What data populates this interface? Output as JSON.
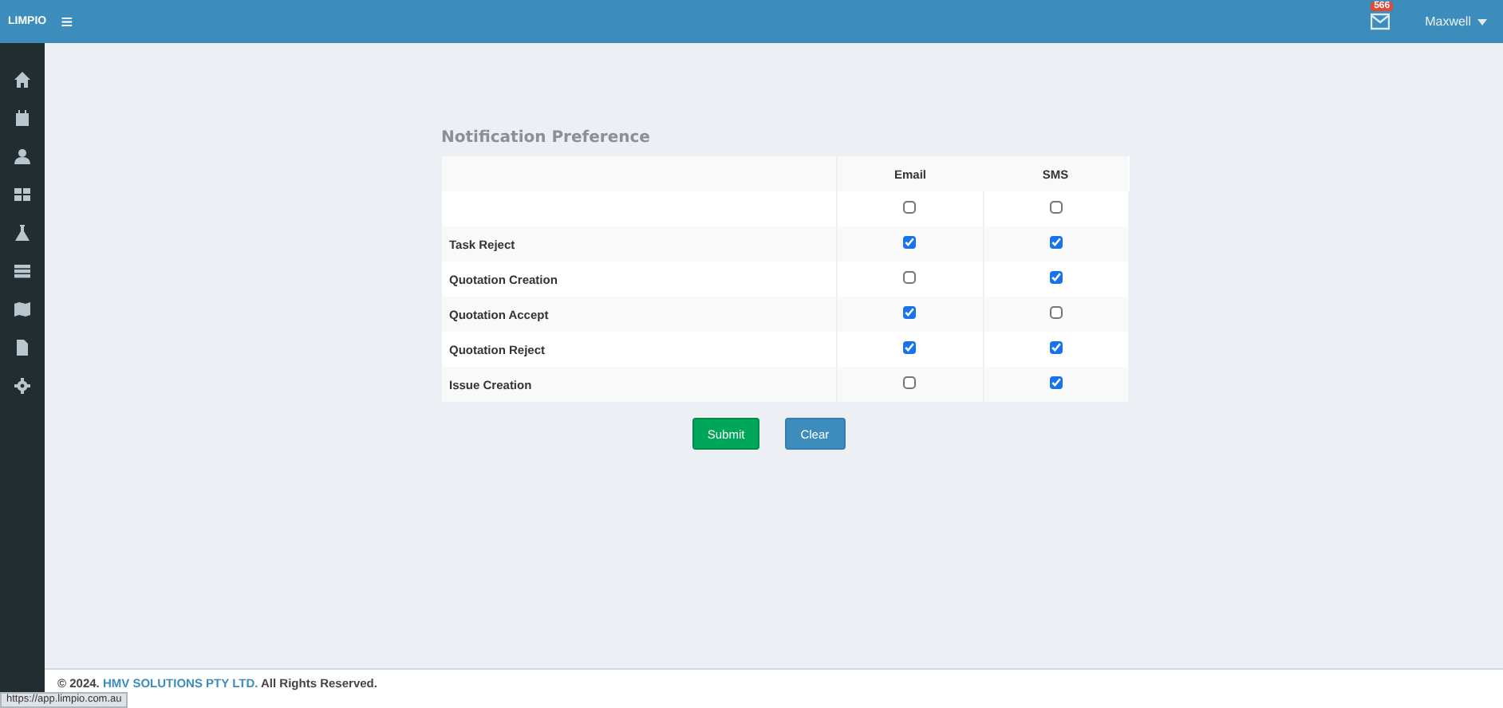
{
  "topbar": {
    "logo": "LIMPIO",
    "menu_icon": "≡",
    "notification_count": "566",
    "user": "Maxwell"
  },
  "sidebar": {
    "items": [
      {
        "kind": "home"
      },
      {
        "kind": "calendar"
      },
      {
        "kind": "user"
      },
      {
        "kind": "grid"
      },
      {
        "kind": "flask"
      },
      {
        "kind": "list"
      },
      {
        "kind": "map"
      },
      {
        "kind": "file"
      },
      {
        "kind": "gear"
      }
    ]
  },
  "title": "Notification Preference",
  "table": {
    "columns": [
      "Email",
      "SMS"
    ],
    "select_all": {
      "email": false,
      "sms": false
    },
    "rows": [
      {
        "label": "Task Reject",
        "email": true,
        "sms": true
      },
      {
        "label": "Quotation Creation",
        "email": false,
        "sms": true
      },
      {
        "label": "Quotation Accept",
        "email": true,
        "sms": false
      },
      {
        "label": "Quotation Reject",
        "email": true,
        "sms": true
      },
      {
        "label": "Issue Creation",
        "email": false,
        "sms": true
      }
    ]
  },
  "buttons": [
    {
      "label": "Submit",
      "kind": "primary"
    },
    {
      "label": "Clear",
      "kind": "secondary"
    }
  ],
  "footer": {
    "before": "© 2024.",
    "link": "HMV SOLUTIONS PTY LTD.",
    "after": "All Rights Reserved."
  },
  "status_url": "https://app.limpio.com.au"
}
